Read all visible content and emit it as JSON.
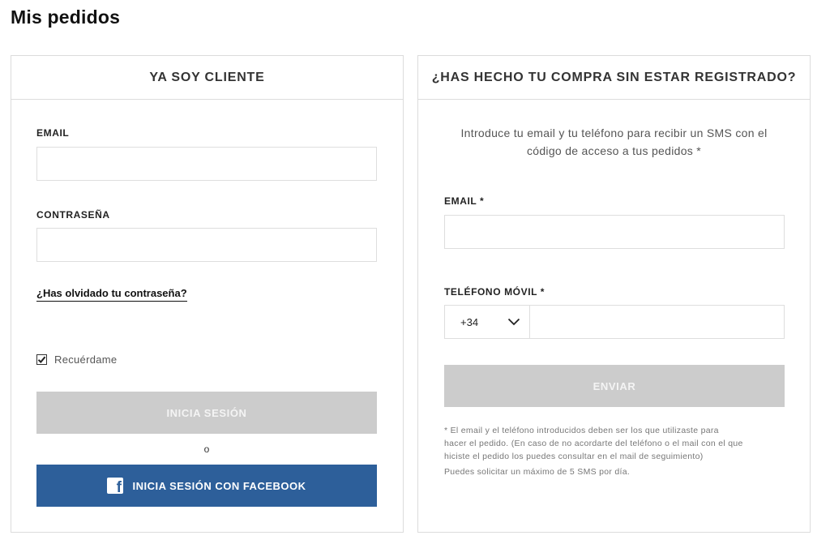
{
  "page": {
    "title": "Mis pedidos"
  },
  "login": {
    "header": "YA SOY CLIENTE",
    "email_label": "EMAIL",
    "email_value": "",
    "password_label": "CONTRASEÑA",
    "password_value": "",
    "forgot_link": "¿Has olvidado tu contraseña?",
    "remember_label": "Recuérdame",
    "remember_checked": true,
    "login_button": "INICIA SESIÓN",
    "or_text": "o",
    "facebook_button": "INICIA SESIÓN CON FACEBOOK"
  },
  "guest": {
    "header": "¿HAS HECHO TU COMPRA SIN ESTAR REGISTRADO?",
    "intro_line1": "Introduce tu email y tu teléfono para recibir un SMS con el",
    "intro_line2": "código de acceso a tus pedidos *",
    "email_label": "EMAIL *",
    "email_value": "",
    "phone_label": "TELÉFONO MÓVIL *",
    "phone_prefix": "+34",
    "phone_value": "",
    "send_button": "ENVIAR",
    "note_line1": "* El email y el teléfono introducidos deben ser los que utilizaste para",
    "note_line2": "hacer el pedido. (En caso de no acordarte del teléfono o el mail con el que",
    "note_line3": "hiciste el pedido los puedes consultar en el mail de seguimiento)",
    "note_line4": "Puedes solicitar un máximo de 5 SMS por día."
  },
  "colors": {
    "facebook_blue": "#2d5f9a",
    "disabled_button": "#cccccc",
    "border": "#dcdcdc"
  },
  "icons": {
    "facebook": "facebook-icon",
    "chevron": "chevron-down-icon",
    "check": "checkmark-icon"
  }
}
